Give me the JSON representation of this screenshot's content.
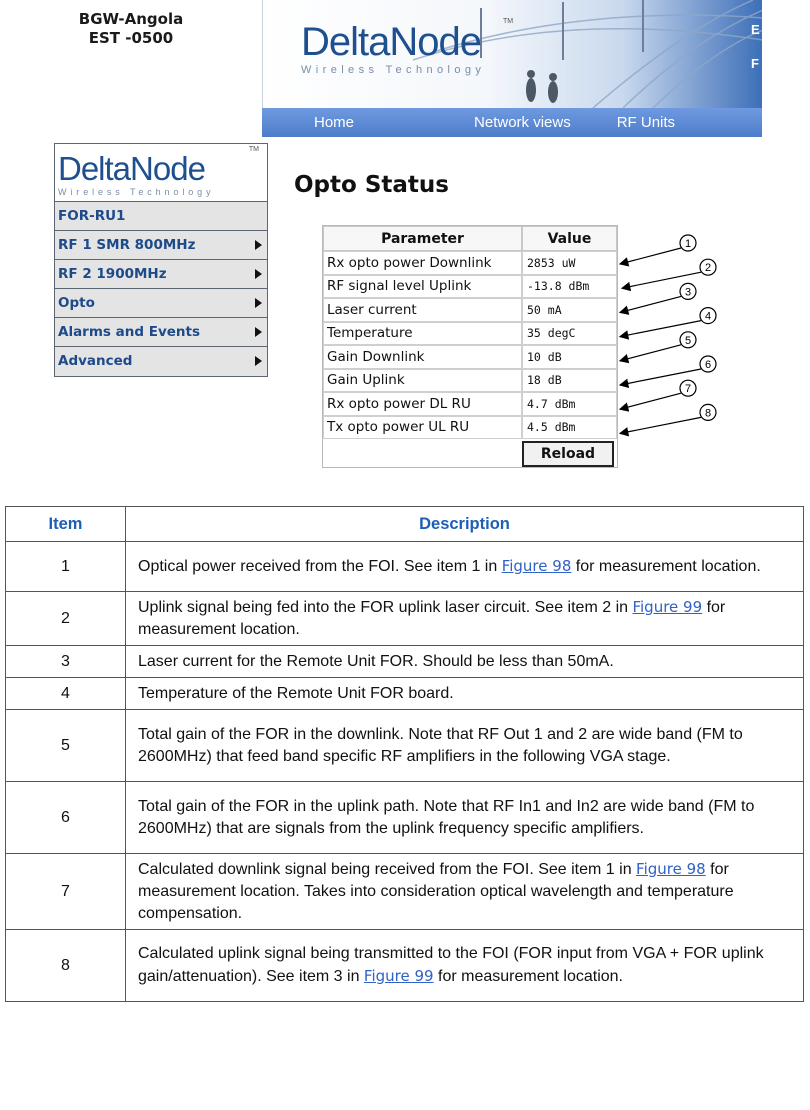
{
  "site": {
    "name": "BGW-Angola",
    "timezone": "EST -0500"
  },
  "brand": {
    "name": "DeltaNode",
    "tagline": "Wireless Technology",
    "tm": "TM"
  },
  "banner": {
    "cut_text_1": "E",
    "cut_text_2": "F"
  },
  "nav": {
    "items": [
      "Home",
      "Network views",
      "RF Units"
    ]
  },
  "sidebar": {
    "items": [
      {
        "label": "FOR-RU1",
        "arrow": false
      },
      {
        "label": "RF 1 SMR 800MHz",
        "arrow": true
      },
      {
        "label": "RF 2 1900MHz",
        "arrow": true
      },
      {
        "label": "Opto",
        "arrow": true
      },
      {
        "label": "Alarms and Events",
        "arrow": true
      },
      {
        "label": "Advanced",
        "arrow": true
      }
    ]
  },
  "opto": {
    "title": "Opto Status",
    "headers": {
      "parameter": "Parameter",
      "value": "Value"
    },
    "rows": [
      {
        "param": "Rx opto power Downlink",
        "value": "2853 uW"
      },
      {
        "param": "RF signal level Uplink",
        "value": "-13.8 dBm"
      },
      {
        "param": "Laser current",
        "value": "50 mA"
      },
      {
        "param": "Temperature",
        "value": "35 degC"
      },
      {
        "param": "Gain Downlink",
        "value": "10 dB"
      },
      {
        "param": "Gain Uplink",
        "value": "18 dB"
      },
      {
        "param": "Rx opto power DL RU",
        "value": "4.7 dBm"
      },
      {
        "param": "Tx opto power UL RU",
        "value": "4.5 dBm"
      }
    ],
    "reload_label": "Reload",
    "callouts": [
      "1",
      "2",
      "3",
      "4",
      "5",
      "6",
      "7",
      "8"
    ]
  },
  "desc_table": {
    "headers": {
      "item": "Item",
      "description": "Description"
    },
    "rows": [
      {
        "item": "1",
        "parts": [
          {
            "t": "Optical power received from the FOI. See item 1 in "
          },
          {
            "t": "Figure 98",
            "link": true
          },
          {
            "t": " for measurement location."
          }
        ]
      },
      {
        "item": "2",
        "parts": [
          {
            "t": "Uplink signal being fed into the FOR uplink laser circuit. See item 2 in "
          },
          {
            "t": "Figure 99",
            "link": true
          },
          {
            "t": " for measurement location."
          }
        ]
      },
      {
        "item": "3",
        "parts": [
          {
            "t": "Laser current for the Remote Unit FOR. Should be less than 50mA."
          }
        ]
      },
      {
        "item": "4",
        "parts": [
          {
            "t": "Temperature of the Remote Unit FOR board."
          }
        ]
      },
      {
        "item": "5",
        "parts": [
          {
            "t": "Total gain of the FOR in the downlink. Note that RF Out 1 and 2 are wide band (FM to 2600MHz) that feed band specific RF amplifiers in the following VGA stage."
          }
        ]
      },
      {
        "item": "6",
        "parts": [
          {
            "t": "Total gain of the FOR in the uplink path. Note that RF In1 and In2 are wide band (FM to 2600MHz) that are signals from the uplink frequency specific amplifiers."
          }
        ]
      },
      {
        "item": "7",
        "parts": [
          {
            "t": "Calculated downlink signal being received from the FOI.   See item 1 in "
          },
          {
            "t": "Figure 98",
            "link": true
          },
          {
            "t": " for measurement location. Takes into consideration optical wavelength and temperature compensation."
          }
        ]
      },
      {
        "item": "8",
        "parts": [
          {
            "t": "Calculated uplink signal being transmitted to the FOI (FOR input from VGA + FOR uplink gain/attenuation). See item 3 in "
          },
          {
            "t": "Figure 99",
            "link": true
          },
          {
            "t": " for measurement location."
          }
        ]
      }
    ]
  }
}
